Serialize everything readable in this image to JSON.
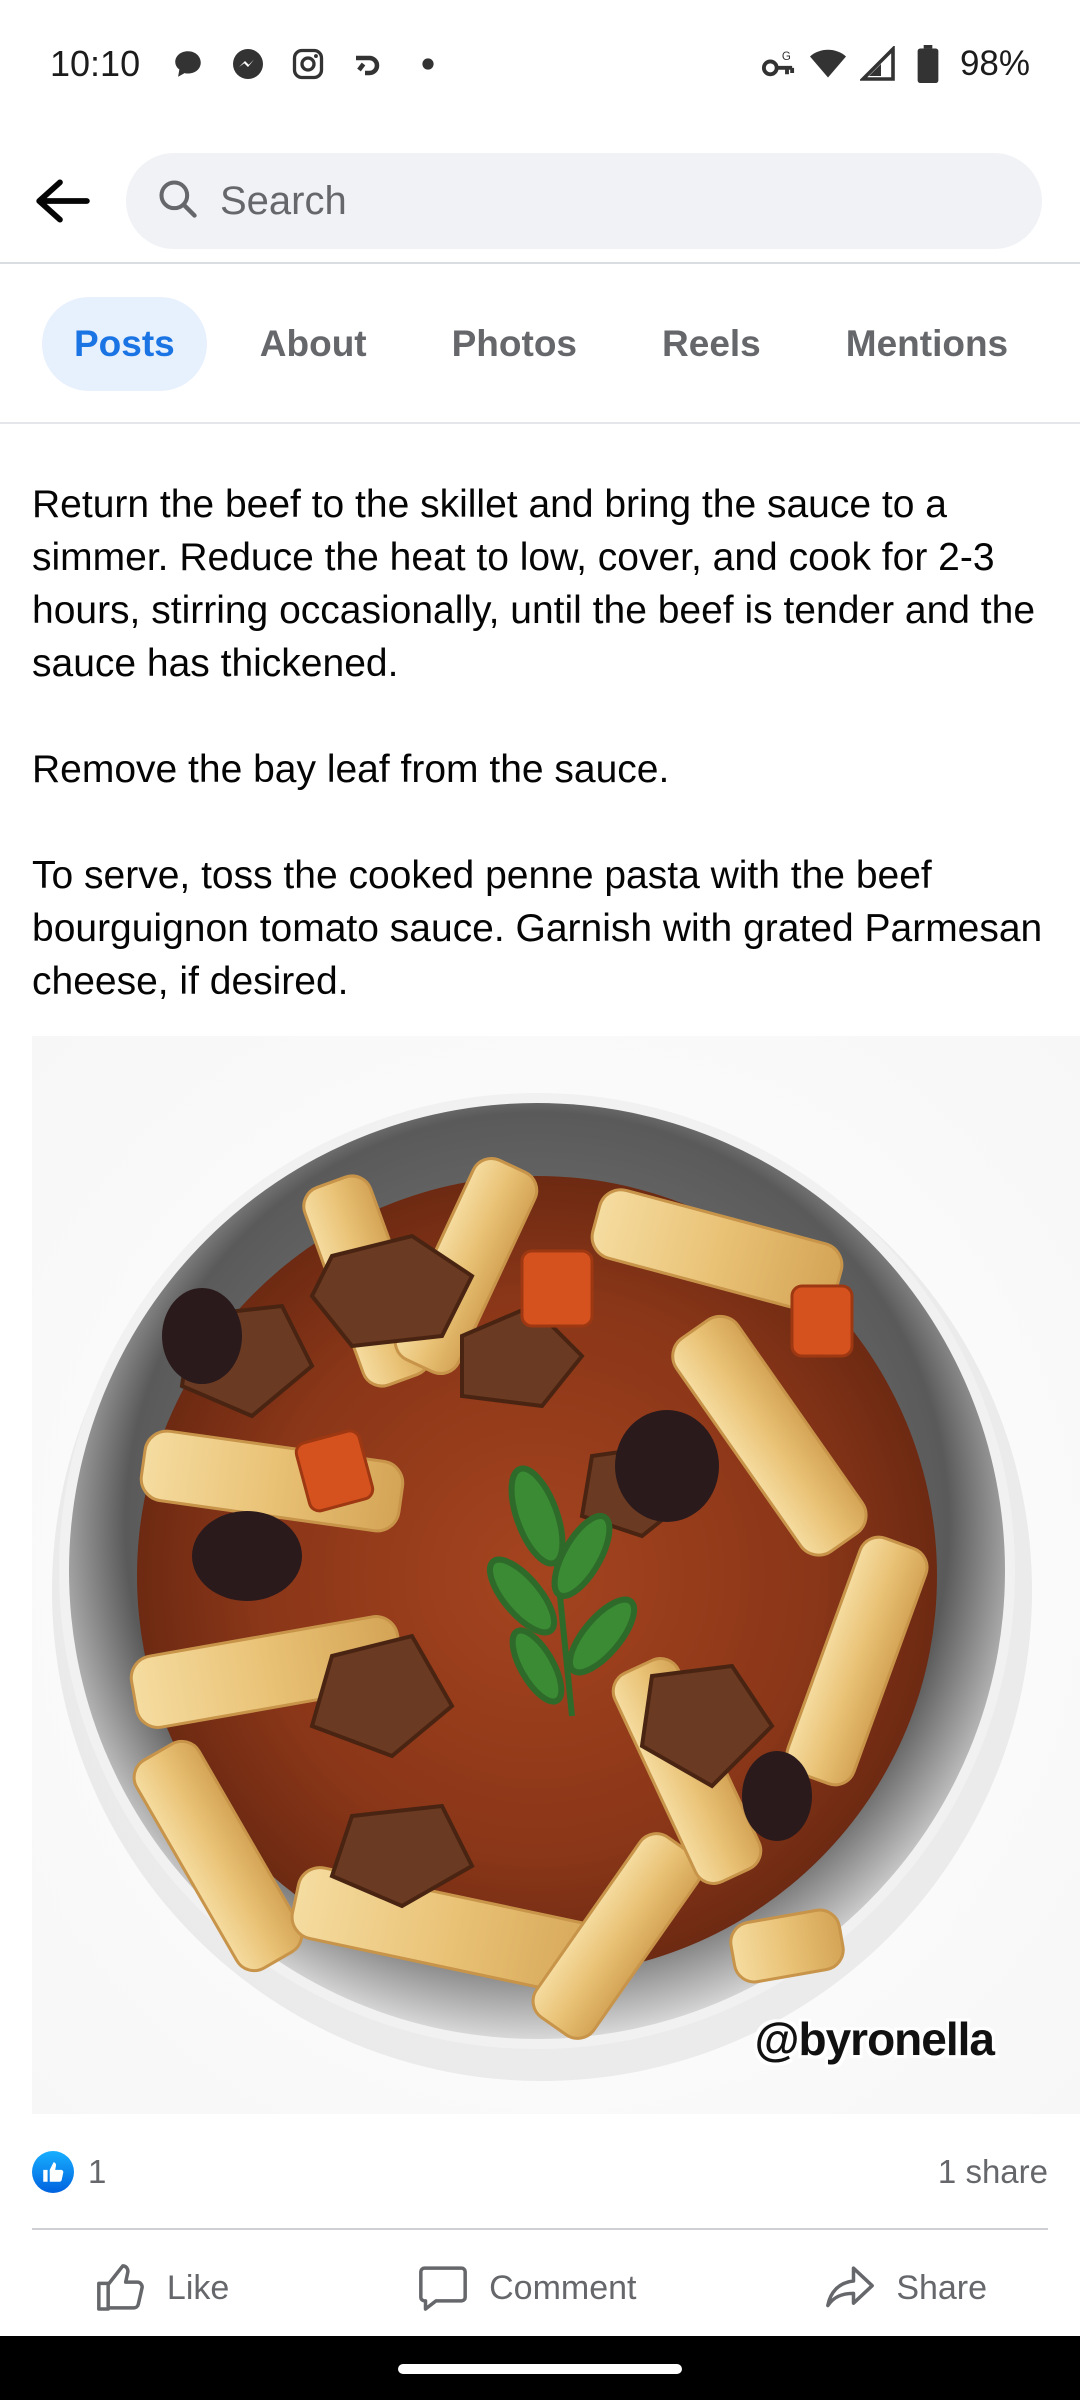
{
  "status_bar": {
    "time": "10:10",
    "battery": "98%",
    "icons_left": [
      "chat-bubble-icon",
      "messenger-icon",
      "instagram-icon",
      "reply-arrow-icon",
      "dot-icon"
    ],
    "icons_right": [
      "vpn-key-icon",
      "wifi-icon",
      "signal-icon",
      "battery-icon"
    ]
  },
  "search": {
    "placeholder": "Search"
  },
  "tabs": [
    {
      "label": "Posts",
      "active": true
    },
    {
      "label": "About",
      "active": false
    },
    {
      "label": "Photos",
      "active": false
    },
    {
      "label": "Reels",
      "active": false
    },
    {
      "label": "Mentions",
      "active": false
    }
  ],
  "post": {
    "paragraphs": [
      "Return the beef to the skillet and bring the sauce to a simmer. Reduce the heat to low, cover, and cook for 2-3 hours, stirring occasionally, until the beef is tender and the sauce has thickened.",
      "Remove the bay leaf from the sauce.",
      "To serve, toss the cooked penne pasta with the beef bourguignon tomato sauce. Garnish with grated Parmesan cheese, if desired."
    ],
    "image_watermark": "@byronella",
    "reaction_count": "1",
    "share_count": "1 share"
  },
  "actions": {
    "like": "Like",
    "comment": "Comment",
    "share": "Share"
  },
  "colors": {
    "accent": "#1b74e4",
    "active_tab_bg": "#e7f0fd",
    "secondary_text": "#65676b"
  }
}
